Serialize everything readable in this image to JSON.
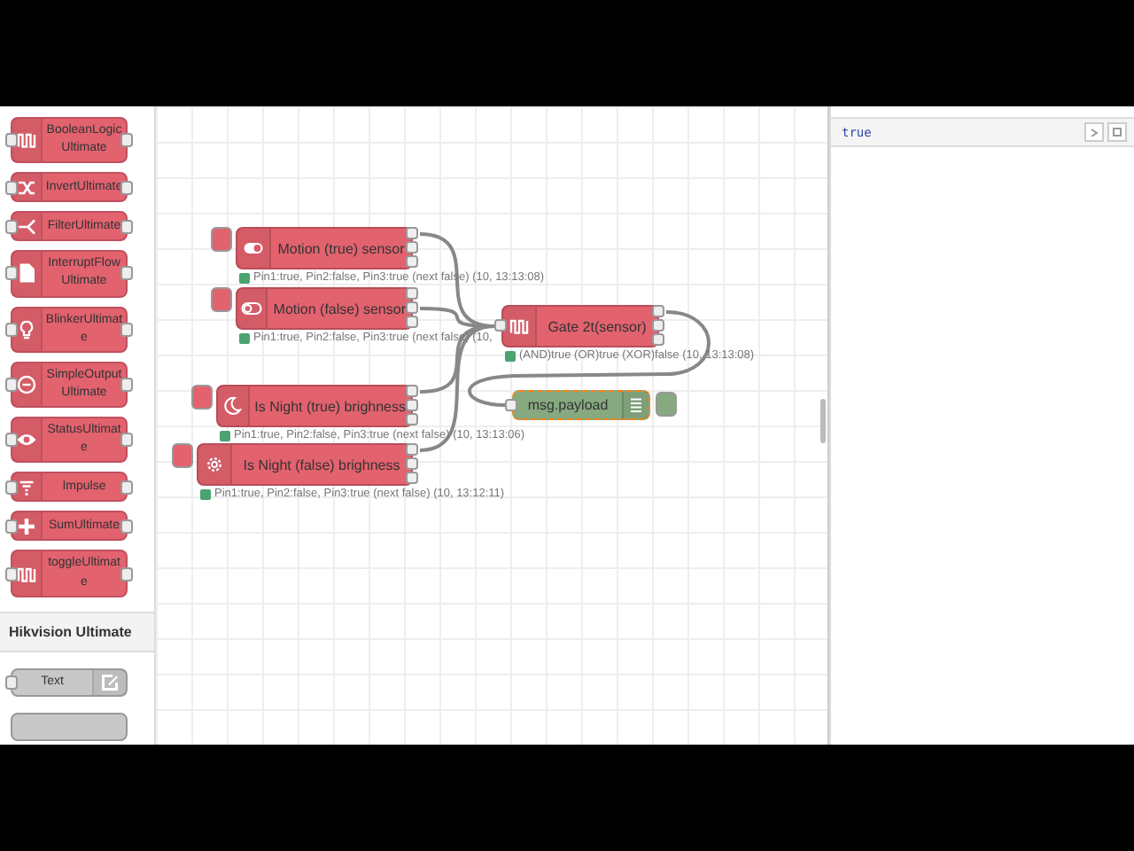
{
  "palette": {
    "items": [
      {
        "label": "BooleanLogic Ultimate"
      },
      {
        "label": "InvertUltimate"
      },
      {
        "label": "FilterUltimate"
      },
      {
        "label": "InterruptFlow Ultimate"
      },
      {
        "label": "BlinkerUltimat e"
      },
      {
        "label": "SimpleOutput Ultimate"
      },
      {
        "label": "StatusUltimat e"
      },
      {
        "label": "Impulse"
      },
      {
        "label": "SumUltimate"
      },
      {
        "label": "toggleUltimat e"
      }
    ],
    "category": "Hikvision Ultimate",
    "category_items": [
      {
        "label": "Text"
      }
    ]
  },
  "flow": {
    "nodes": [
      {
        "kind": "inject",
        "label": "Motion (true) sensor",
        "status": "Pin1:true, Pin2:false, Pin3:true (next false) (10, 13:13:08)"
      },
      {
        "kind": "inject",
        "label": "Motion (false) sensor",
        "status": "Pin1:true, Pin2:false, Pin3:true (next false) (10,"
      },
      {
        "kind": "inject",
        "label": "Is Night (true) brighness",
        "status": "Pin1:true, Pin2:false, Pin3:true (next false) (10, 13:13:06)"
      },
      {
        "kind": "inject",
        "label": "Is Night (false) brighness",
        "status": "Pin1:true, Pin2:false, Pin3:true (next false) (10, 13:12:11)"
      },
      {
        "kind": "logic",
        "label": "Gate 2t(sensor)",
        "status": "(AND)true (OR)true (XOR)false (10, 13:13:08)"
      },
      {
        "kind": "debug",
        "label": "msg.payload",
        "active": true,
        "changed": true
      }
    ]
  },
  "debug": {
    "messages": [
      {
        "value": "true"
      }
    ]
  }
}
